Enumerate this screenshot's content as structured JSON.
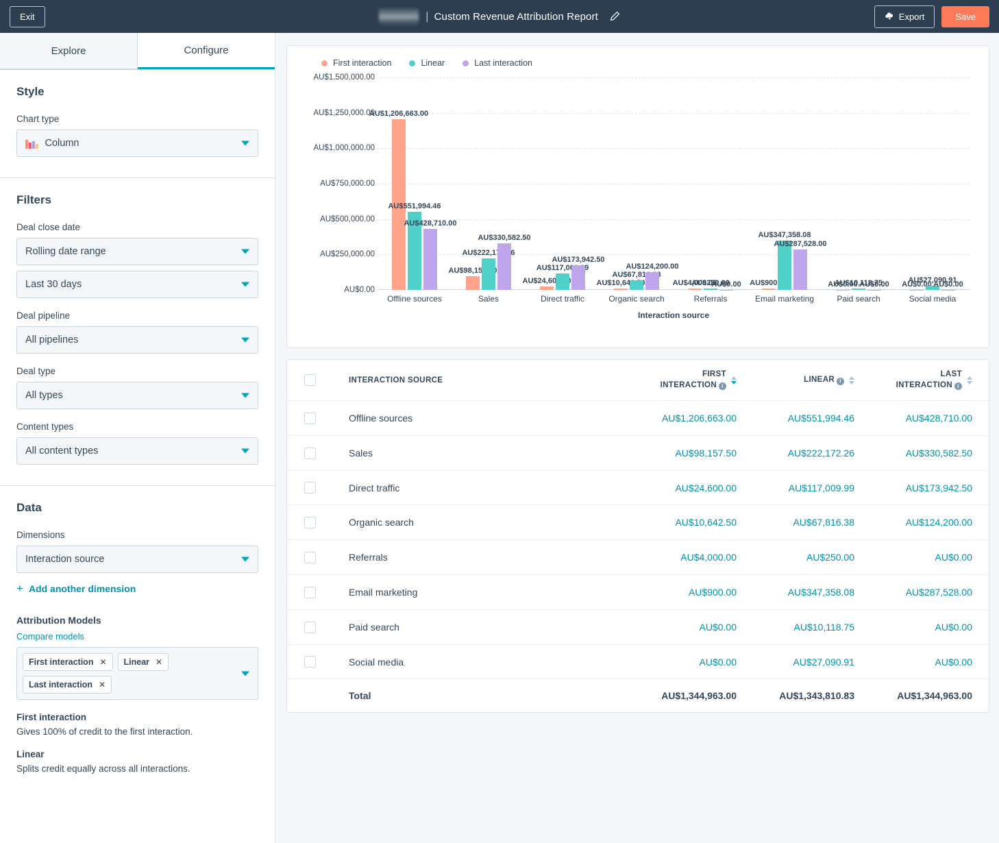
{
  "topbar": {
    "exit_label": "Exit",
    "logo": "redacted-logo",
    "separator": "|",
    "report_title": "Custom Revenue Attribution Report",
    "edit_icon": "pencil-icon",
    "export_label": "Export",
    "export_icon": "cloud-download-icon",
    "save_label": "Save"
  },
  "sidebar": {
    "tabs": [
      {
        "label": "Explore",
        "active": false
      },
      {
        "label": "Configure",
        "active": true
      }
    ],
    "style": {
      "heading": "Style",
      "chart_type_label": "Chart type",
      "chart_type_value": "Column",
      "chart_type_icon": "column-chart-icon"
    },
    "filters": {
      "heading": "Filters",
      "fields": [
        {
          "label": "Deal close date",
          "value": "Rolling date range"
        },
        {
          "label": "",
          "value": "Last 30 days"
        },
        {
          "label": "Deal pipeline",
          "value": "All pipelines"
        },
        {
          "label": "Deal type",
          "value": "All types"
        },
        {
          "label": "Content types",
          "value": "All content types"
        }
      ]
    },
    "data": {
      "heading": "Data",
      "dimensions_label": "Dimensions",
      "dimensions_value": "Interaction source",
      "add_dimension_label": "Add another dimension",
      "attribution_models_label": "Attribution Models",
      "compare_models_label": "Compare models",
      "model_chips": [
        "First interaction",
        "Linear",
        "Last interaction"
      ],
      "descriptions": [
        {
          "title": "First interaction",
          "body": "Gives 100% of credit to the first interaction."
        },
        {
          "title": "Linear",
          "body": "Splits credit equally across all interactions."
        }
      ]
    }
  },
  "chart_data": {
    "type": "bar",
    "title": "",
    "xlabel": "Interaction source",
    "ylabel": "",
    "ylim": [
      0,
      1500000
    ],
    "grid": true,
    "legend_position": "top-left",
    "ticks": [
      "AU$0.00",
      "AU$250,000.00",
      "AU$500,000.00",
      "AU$750,000.00",
      "AU$1,000,000.00",
      "AU$1,250,000.00",
      "AU$1,500,000.00"
    ],
    "tick_values": [
      0,
      250000,
      500000,
      750000,
      1000000,
      1250000,
      1500000
    ],
    "categories": [
      "Offline sources",
      "Sales",
      "Direct traffic",
      "Organic search",
      "Referrals",
      "Email marketing",
      "Paid search",
      "Social media"
    ],
    "series": [
      {
        "name": "First interaction",
        "color": "#FFA38B",
        "values": [
          1206663.0,
          98157.5,
          24600.0,
          10642.5,
          4000.0,
          900.0,
          0.0,
          0.0
        ],
        "labels": [
          "AU$1,206,663.00",
          "AU$98,157.50",
          "AU$24,600.00",
          "AU$10,642.50",
          "AU$4,000.00",
          "AU$900.00",
          "AU$0.00",
          "AU$0.00"
        ]
      },
      {
        "name": "Linear",
        "color": "#4FD1CA",
        "values": [
          551994.46,
          222172.26,
          117009.99,
          67816.38,
          250.0,
          347358.08,
          10118.75,
          27090.91
        ],
        "labels": [
          "AU$551,994.46",
          "AU$222,172.26",
          "AU$117,009.99",
          "AU$67,816.38",
          "AU$250.00",
          "AU$347,358.08",
          "AU$10,118.75",
          "AU$27,090.91"
        ]
      },
      {
        "name": "Last interaction",
        "color": "#BFA5EC",
        "values": [
          428710.0,
          330582.5,
          173942.5,
          124200.0,
          0.0,
          287528.0,
          0.0,
          0.0
        ],
        "labels": [
          "AU$428,710.00",
          "AU$330,582.50",
          "AU$173,942.50",
          "AU$124,200.00",
          "AU$0.00",
          "AU$287,528.00",
          "AU$0.00",
          "AU$0.00"
        ]
      }
    ]
  },
  "table": {
    "headers": {
      "source": "INTERACTION SOURCE",
      "first_line1": "FIRST",
      "first_line2": "INTERACTION",
      "linear": "LINEAR",
      "last_line1": "LAST",
      "last_line2": "INTERACTION"
    },
    "rows": [
      {
        "source": "Offline sources",
        "first": "AU$1,206,663.00",
        "linear": "AU$551,994.46",
        "last": "AU$428,710.00"
      },
      {
        "source": "Sales",
        "first": "AU$98,157.50",
        "linear": "AU$222,172.26",
        "last": "AU$330,582.50"
      },
      {
        "source": "Direct traffic",
        "first": "AU$24,600.00",
        "linear": "AU$117,009.99",
        "last": "AU$173,942.50"
      },
      {
        "source": "Organic search",
        "first": "AU$10,642.50",
        "linear": "AU$67,816.38",
        "last": "AU$124,200.00"
      },
      {
        "source": "Referrals",
        "first": "AU$4,000.00",
        "linear": "AU$250.00",
        "last": "AU$0.00"
      },
      {
        "source": "Email marketing",
        "first": "AU$900.00",
        "linear": "AU$347,358.08",
        "last": "AU$287,528.00"
      },
      {
        "source": "Paid search",
        "first": "AU$0.00",
        "linear": "AU$10,118.75",
        "last": "AU$0.00"
      },
      {
        "source": "Social media",
        "first": "AU$0.00",
        "linear": "AU$27,090.91",
        "last": "AU$0.00"
      }
    ],
    "total": {
      "source": "Total",
      "first": "AU$1,344,963.00",
      "linear": "AU$1,343,810.83",
      "last": "AU$1,344,963.00"
    }
  },
  "colors": {
    "accent": "#00a4bd",
    "link": "#0091ae",
    "brand_orange": "#ff7a59",
    "dark_navy": "#2d3e50",
    "text": "#33475b"
  }
}
